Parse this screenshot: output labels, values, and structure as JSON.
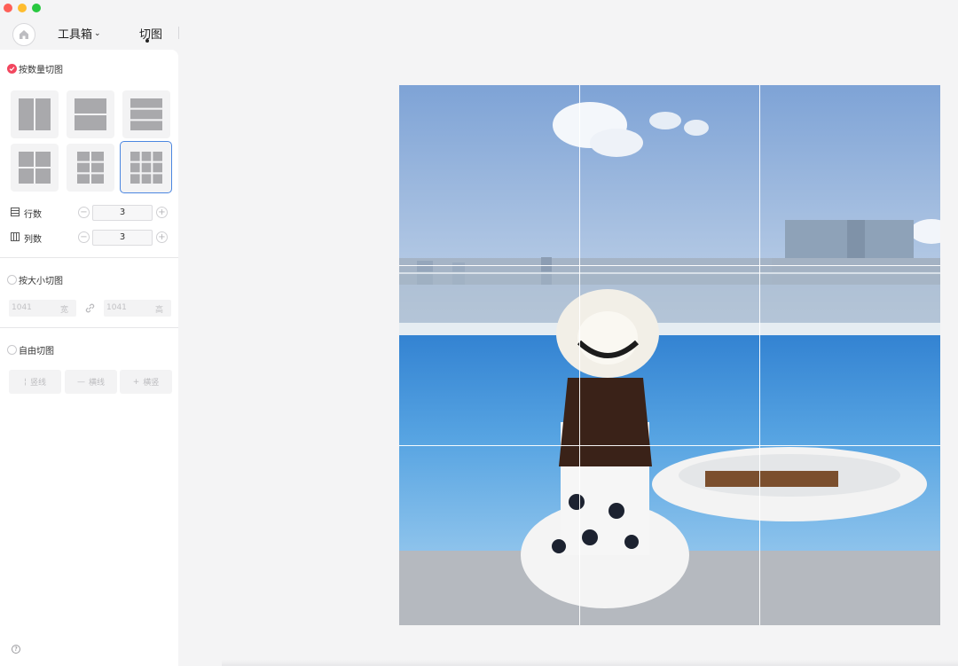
{
  "window": {
    "title_tab": "切图"
  },
  "toolbar": {
    "toolbox_label": "工具箱",
    "toolbox_chevron": "⌄",
    "active_tab": "切图"
  },
  "sidebar": {
    "by_count": {
      "label": "按数量切图",
      "selected": true,
      "layouts": [
        "2-columns",
        "2-rows",
        "3-rows",
        "2x2-grid",
        "2x3-grid",
        "3x3-grid"
      ],
      "selected_layout": "3x3-grid",
      "rows": {
        "label": "行数",
        "value": "3"
      },
      "cols": {
        "label": "列数",
        "value": "3"
      }
    },
    "by_size": {
      "label": "按大小切图",
      "width": {
        "placeholder": "1041",
        "unit": "宽"
      },
      "height": {
        "placeholder": "1041",
        "unit": "高"
      }
    },
    "free": {
      "label": "自由切图",
      "buttons": [
        {
          "icon": "¦",
          "label": "竖线"
        },
        {
          "icon": "—",
          "label": "横线"
        },
        {
          "icon": "+",
          "label": "横竖"
        }
      ]
    },
    "help_glyph": "?"
  },
  "canvas": {
    "grid_rows": 3,
    "grid_cols": 3,
    "accent_color": "#4b86e0",
    "selected_color": "#f2475f"
  }
}
